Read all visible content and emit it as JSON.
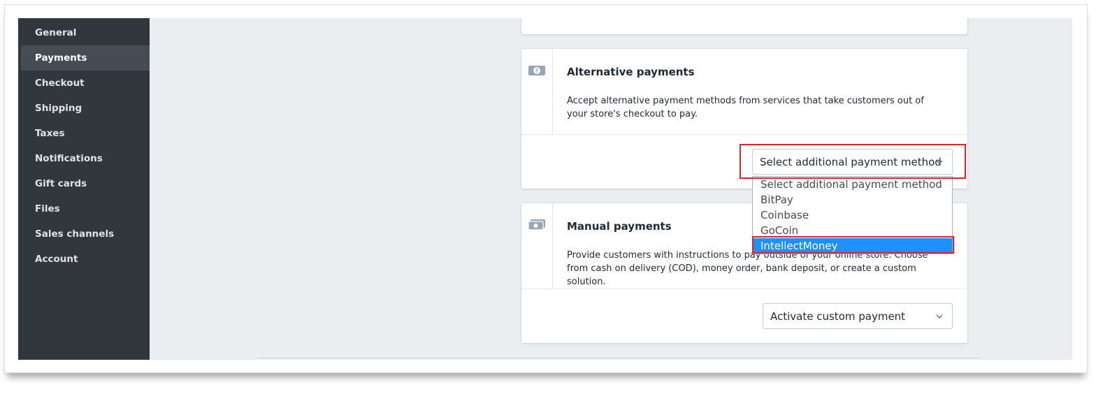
{
  "sidebar": {
    "items": [
      {
        "label": "General"
      },
      {
        "label": "Payments"
      },
      {
        "label": "Checkout"
      },
      {
        "label": "Shipping"
      },
      {
        "label": "Taxes"
      },
      {
        "label": "Notifications"
      },
      {
        "label": "Gift cards"
      },
      {
        "label": "Files"
      },
      {
        "label": "Sales channels"
      },
      {
        "label": "Account"
      }
    ],
    "active": "Payments"
  },
  "alternative": {
    "title": "Alternative payments",
    "description": "Accept alternative payment methods from services that take customers out of your store's checkout to pay.",
    "select_value": "Select additional payment method",
    "options": [
      "Select additional payment method",
      "BitPay",
      "Coinbase",
      "GoCoin",
      "IntellectMoney"
    ],
    "highlighted_option": "IntellectMoney"
  },
  "manual": {
    "title": "Manual payments",
    "description": "Provide customers with instructions to pay outside of your online store. Choose from cash on delivery (COD), money order, bank deposit, or create a custom solution.",
    "select_value": "Activate custom payment"
  },
  "colors": {
    "sidebar_bg": "#31373d",
    "sidebar_active": "#454c53",
    "annotation_red": "#d4262c",
    "option_selected": "#1e90ff"
  }
}
